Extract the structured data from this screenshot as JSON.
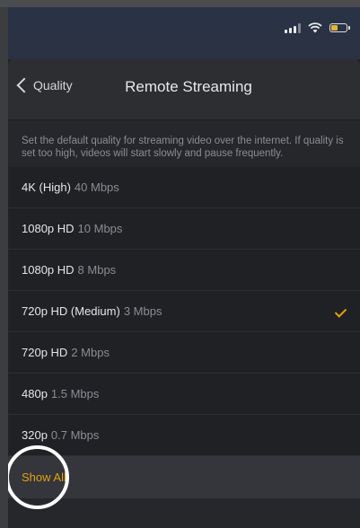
{
  "status_bar": {
    "icons": [
      "signal-icon",
      "wifi-icon",
      "battery-charging-icon"
    ],
    "battery_color": "#e7b334"
  },
  "nav": {
    "back_label": "Quality",
    "title": "Remote Streaming"
  },
  "description": "Set the default quality for streaming video over the internet. If quality is set too high, videos will start slowly and pause frequently.",
  "options": [
    {
      "name": "4K (High)",
      "rate": "40 Mbps",
      "selected": false
    },
    {
      "name": "1080p HD",
      "rate": "10 Mbps",
      "selected": false
    },
    {
      "name": "1080p HD",
      "rate": "8 Mbps",
      "selected": false
    },
    {
      "name": "720p HD (Medium)",
      "rate": "3 Mbps",
      "selected": true
    },
    {
      "name": "720p HD",
      "rate": "2 Mbps",
      "selected": false
    },
    {
      "name": "480p",
      "rate": "1.5 Mbps",
      "selected": false
    },
    {
      "name": "320p",
      "rate": "0.7 Mbps",
      "selected": false
    }
  ],
  "show_all_label": "Show All",
  "colors": {
    "accent": "#e5a00d",
    "background": "#1f2124",
    "highlight_ring": "#ffffff"
  }
}
